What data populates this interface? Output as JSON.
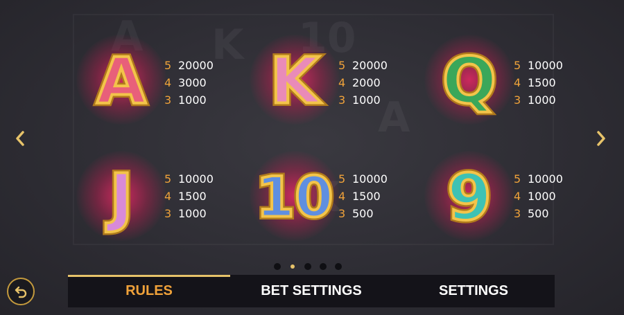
{
  "colors": {
    "accent": "#f0a23a",
    "tab_indicator": "#e7c36a",
    "glow": "#e0286a",
    "background": "#2c2b32"
  },
  "navigation": {
    "prev_icon": "chevron-left-icon",
    "next_icon": "chevron-right-icon"
  },
  "symbols": [
    {
      "id": "a",
      "glyph": "A",
      "fill": "#e8607a",
      "payouts": [
        {
          "count": "5",
          "value": "20000"
        },
        {
          "count": "4",
          "value": "3000"
        },
        {
          "count": "3",
          "value": "1000"
        }
      ]
    },
    {
      "id": "k",
      "glyph": "K",
      "fill": "#e98bb8",
      "payouts": [
        {
          "count": "5",
          "value": "20000"
        },
        {
          "count": "4",
          "value": "2000"
        },
        {
          "count": "3",
          "value": "1000"
        }
      ]
    },
    {
      "id": "q",
      "glyph": "Q",
      "fill": "#3aa75a",
      "payouts": [
        {
          "count": "5",
          "value": "10000"
        },
        {
          "count": "4",
          "value": "1500"
        },
        {
          "count": "3",
          "value": "1000"
        }
      ]
    },
    {
      "id": "j",
      "glyph": "J",
      "fill": "#d88ad8",
      "payouts": [
        {
          "count": "5",
          "value": "10000"
        },
        {
          "count": "4",
          "value": "1500"
        },
        {
          "count": "3",
          "value": "1000"
        }
      ]
    },
    {
      "id": "10",
      "glyph": "10",
      "fill": "#5f8fe0",
      "payouts": [
        {
          "count": "5",
          "value": "10000"
        },
        {
          "count": "4",
          "value": "1500"
        },
        {
          "count": "3",
          "value": "500"
        }
      ]
    },
    {
      "id": "9",
      "glyph": "9",
      "fill": "#3ec2b4",
      "payouts": [
        {
          "count": "5",
          "value": "10000"
        },
        {
          "count": "4",
          "value": "1000"
        },
        {
          "count": "3",
          "value": "500"
        }
      ]
    }
  ],
  "pagination": {
    "total": 5,
    "current": 2
  },
  "back_button": {
    "icon": "undo-arrow-icon"
  },
  "tabs": [
    {
      "label": "RULES",
      "active": true
    },
    {
      "label": "BET SETTINGS",
      "active": false
    },
    {
      "label": "SETTINGS",
      "active": false
    }
  ]
}
